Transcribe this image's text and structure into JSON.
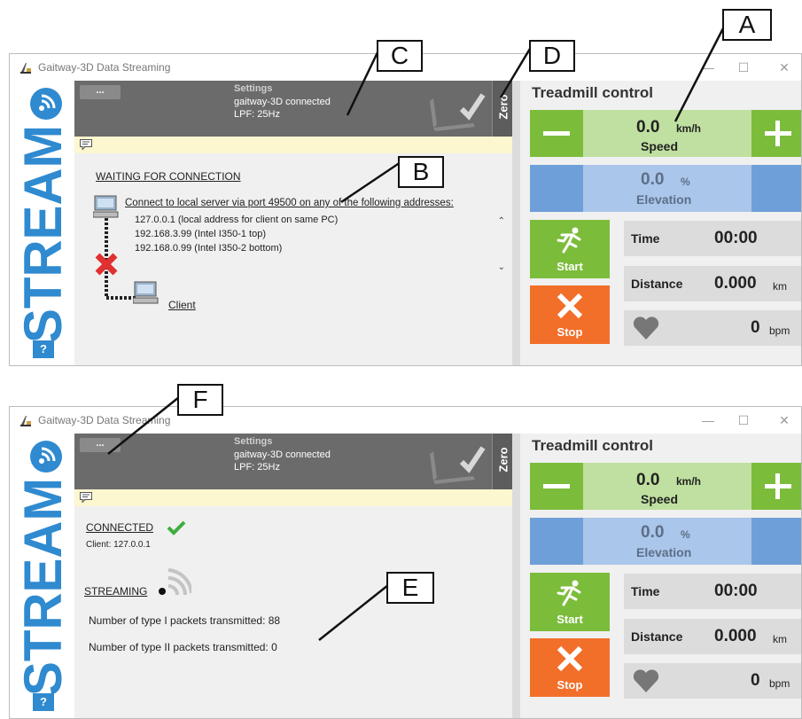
{
  "top_window": {
    "title": "Gaitway-3D Data Streaming",
    "dots_label": "...",
    "settings": {
      "title": "Settings",
      "line1": "gaitway-3D connected",
      "line2": "LPF: 25Hz"
    },
    "zero_label": "Zero",
    "status_heading": "WAITING FOR CONNECTION",
    "connect_text": "Connect to local server via port 49500 on any of the following addresses:",
    "addresses": [
      "127.0.0.1 (local address for client on same PC)",
      "192.168.3.99 (Intel I350-1 top)",
      "192.168.0.99 (Intel I350-2 bottom)"
    ],
    "client_label": "Client"
  },
  "bottom_window": {
    "title": "Gaitway-3D Data Streaming",
    "dots_label": "...",
    "settings": {
      "title": "Settings",
      "line1": "gaitway-3D connected",
      "line2": "LPF: 25Hz"
    },
    "zero_label": "Zero",
    "connected_heading": "CONNECTED",
    "client_text": "Client: 127.0.0.1",
    "streaming_heading": "STREAMING",
    "type1_text": "Number of type I packets transmitted: 88",
    "type2_text": "Number of type II packets transmitted: 0"
  },
  "treadmill": {
    "title": "Treadmill control",
    "speed_value": "0.0",
    "speed_unit": "km/h",
    "speed_label": "Speed",
    "elevation_value": "0.0",
    "elevation_unit": "%",
    "elevation_label": "Elevation",
    "start_label": "Start",
    "stop_label": "Stop",
    "time_label": "Time",
    "time_value": "00:00",
    "distance_label": "Distance",
    "distance_value": "0.000",
    "distance_unit": "km",
    "heart_value": "0",
    "heart_unit": "bpm"
  },
  "logo_text": "STREAM",
  "help_label": "?",
  "callouts": [
    "A",
    "B",
    "C",
    "D",
    "E",
    "F"
  ],
  "colors": {
    "green": "#7cbc3b",
    "orange": "#f26f2a",
    "blue": "#2f8ad0",
    "elevation_blue": "#6f9fd8",
    "dark_gray": "#6b6b6b"
  }
}
